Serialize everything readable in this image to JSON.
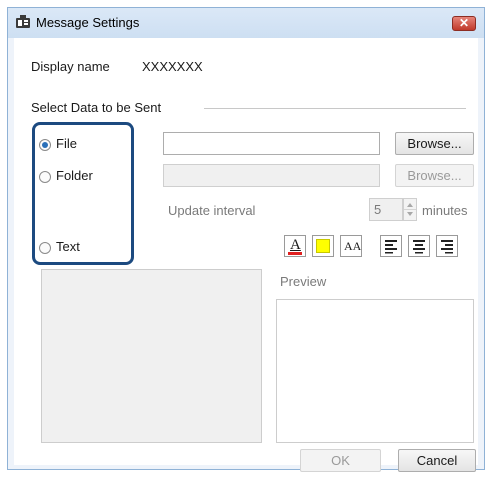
{
  "window": {
    "title": "Message Settings",
    "close_glyph": "✕"
  },
  "display_name": {
    "label": "Display name",
    "value": "XXXXXXX"
  },
  "group": {
    "title": "Select Data to be Sent"
  },
  "options": {
    "file": {
      "label": "File",
      "selected": true
    },
    "folder": {
      "label": "Folder",
      "selected": false
    },
    "text": {
      "label": "Text",
      "selected": false
    }
  },
  "file_row": {
    "path": "",
    "browse_label": "Browse..."
  },
  "folder_row": {
    "path": "",
    "browse_label": "Browse..."
  },
  "update": {
    "label": "Update interval",
    "value": "5",
    "unit": "minutes"
  },
  "format_toolbar": {
    "font_color_glyph": "A",
    "font_size_glyph": "AA",
    "highlight_color": "#ffff00",
    "font_color_underline": "#e02020"
  },
  "preview": {
    "label": "Preview"
  },
  "buttons": {
    "ok": "OK",
    "cancel": "Cancel"
  },
  "accent": {
    "highlight_border": "#1c4a80",
    "radio_dot": "#2a6fb8"
  }
}
